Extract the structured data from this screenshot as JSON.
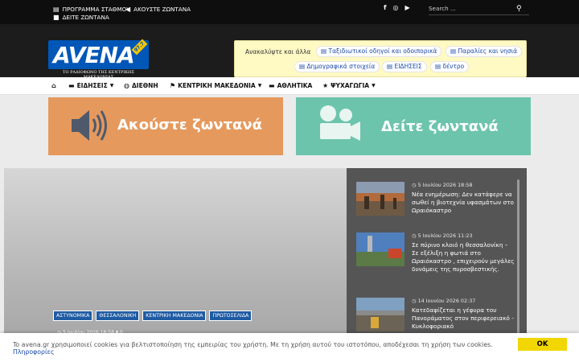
{
  "topbar": {
    "program_label": "ΠΡΟΓΡΑΜΜΑ ΣΤΑΘΜΟΥ",
    "listen_label": "ΑΚΟΥΣΤΕ ΖΩΝΤΑΝΑ",
    "watch_label": "ΔΕΙΤΕ ΖΩΝΤΑΝΑ",
    "search_placeholder": "Search ..."
  },
  "logo": {
    "name": "AVENA",
    "frequency": "97.7",
    "subtitle": "ΤΟ ΡΑΔΙΟΦΩΝΟ ΤΗΣ ΚΕΝΤΡΙΚΗΣ ΜΑΚΕΔΟΝΙΑΣ"
  },
  "discover": {
    "label": "Ανακαλύψτε και άλλα",
    "chips": [
      "Ταξιδιωτικοί οδηγοί και οδοιπορικά",
      "Παραλίες και νησιά",
      "Δημογραφικά στοιχεία",
      "ΕΙΔΗΣΕΙΣ",
      "δέντρο"
    ]
  },
  "nav": {
    "items": [
      "ΕΙΔΗΣΕΙΣ",
      "ΔΙΕΘΝΗ",
      "ΚΕΝΤΡΙΚΗ ΜΑΚΕΔΟΝΙΑ",
      "ΑΘΛΗΤΙΚΑ",
      "ΨΥΧΑΓΩΓΙΑ"
    ]
  },
  "banners": {
    "listen": "Ακούστε ζωντανά",
    "watch": "Δείτε ζωντανά"
  },
  "featured": {
    "tags": [
      "ΑΣΤΥΝΟΜΙΚΑ",
      "ΘΕΣΣΑΛΟΝΙΚΗ",
      "ΚΕΝΤΡΙΚΗ ΜΑΚΕΔΟΝΙΑ",
      "ΠΡΩΤΟΣΕΛΙΔΑ"
    ],
    "date": "5 Ιουλίου 2026 18:58",
    "comments": "0"
  },
  "sidebar": {
    "items": [
      {
        "date": "5 Ιουλίου 2026 18:58",
        "title": "Νέα ενημέρωση: Δεν κατάφερε να σωθεί η βιοτεχνία υφασμάτων στο Ωραιόκαστρο"
      },
      {
        "date": "5 Ιουλίου 2026 11:23",
        "title": "Σε πύρινο κλοιό η θεσσαλονίκη – Σε εξέλιξη η φωτιά στο Ωραιόκαστρο , επιχειρούν μεγάλες δυνάμεις της πυροσβεστικής."
      },
      {
        "date": "14 Ιουνίου 2026 02:37",
        "title": "Κατεδαφίζεται η γέφυρα του Πανοράματος στον περιφερειακό - Κυκλοφοριακό"
      }
    ]
  },
  "cookie": {
    "text": "To avena.gr χρησιμοποιεί cookies για βελτιστοποίηση της εμπειρίας του χρήστη. Με τη χρήση αυτού του ιστοτόπου, αποδέχεσαι τη χρήση των cookies.",
    "link": "Πληροφορίες",
    "ok": "OK"
  }
}
